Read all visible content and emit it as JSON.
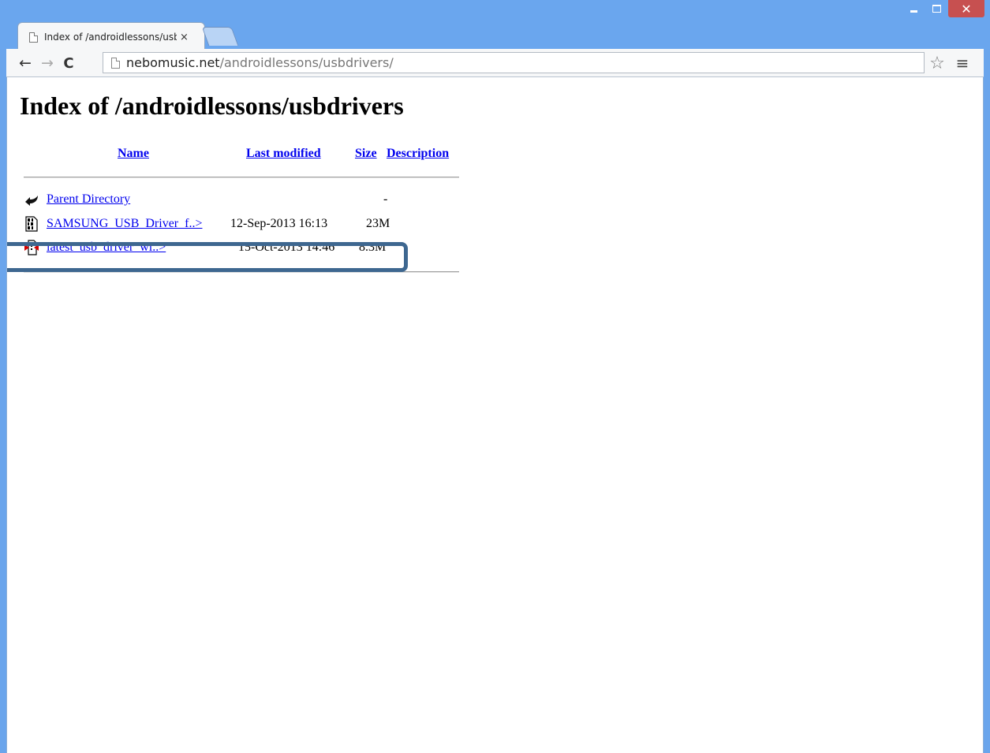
{
  "browser": {
    "tab_title": "Index of /androidlessons/usbdrivers/",
    "tab_close_glyph": "×",
    "url_host": "nebomusic.net",
    "url_path": "/androidlessons/usbdrivers/",
    "nav": {
      "back": "←",
      "forward": "→",
      "reload": "C"
    },
    "star_glyph": "☆",
    "menu_glyph": "≡",
    "close_glyph": "✕"
  },
  "page": {
    "title": "Index of /androidlessons/usbdrivers",
    "columns": {
      "name": "Name",
      "last_modified": "Last modified",
      "size": "Size",
      "description": "Description"
    },
    "rows": [
      {
        "icon": "back-arrow-icon",
        "name": "Parent Directory",
        "date": "",
        "size": "-"
      },
      {
        "icon": "binary-file-icon",
        "name": "SAMSUNG_USB_Driver_f..>",
        "date": "12-Sep-2013 16:13",
        "size": "23M"
      },
      {
        "icon": "compressed-file-icon",
        "name": "latest_usb_driver_wi..>",
        "date": "15-Oct-2013 14:46",
        "size": "8.3M"
      }
    ]
  },
  "colors": {
    "titlebar": "#6aa6ee",
    "link": "#0000ee",
    "highlight_border": "#3e6790",
    "close_button": "#c75050"
  }
}
